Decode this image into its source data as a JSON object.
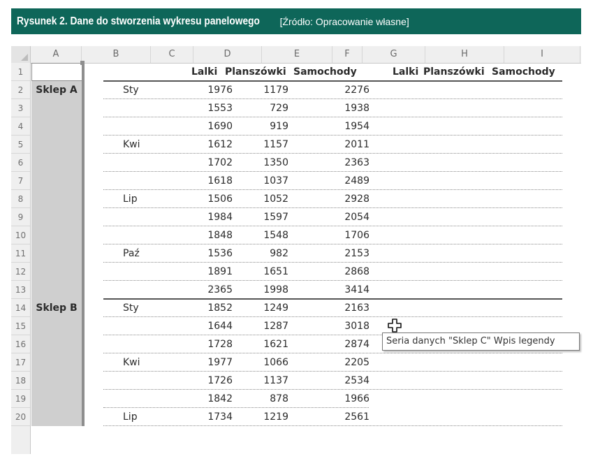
{
  "caption": {
    "title": "Rysunek 2. Dane do stworzenia wykresu panelowego",
    "source": "[Źródło: Opracowanie własne]",
    "background": "#0e6659"
  },
  "columns": [
    "A",
    "B",
    "C",
    "D",
    "E",
    "F",
    "G",
    "H",
    "I"
  ],
  "rows": [
    "1",
    "2",
    "3",
    "4",
    "5",
    "6",
    "7",
    "8",
    "9",
    "10",
    "11",
    "12",
    "13",
    "14",
    "15",
    "16",
    "17",
    "18",
    "19",
    "20"
  ],
  "header_row": {
    "c": "Lalki",
    "d": "Planszówki",
    "e": "Samochody",
    "f": "Lalki",
    "g": "Planszówki",
    "h": "Samochody"
  },
  "stores": {
    "a": "Sklep A",
    "b": "Sklep B"
  },
  "table": [
    {
      "month": "Sty",
      "c": "1976",
      "d": "1179",
      "e": "2276"
    },
    {
      "month": "",
      "c": "1553",
      "d": "729",
      "e": "1938"
    },
    {
      "month": "",
      "c": "1690",
      "d": "919",
      "e": "1954"
    },
    {
      "month": "Kwi",
      "c": "1612",
      "d": "1157",
      "e": "2011"
    },
    {
      "month": "",
      "c": "1702",
      "d": "1350",
      "e": "2363"
    },
    {
      "month": "",
      "c": "1618",
      "d": "1037",
      "e": "2489"
    },
    {
      "month": "Lip",
      "c": "1506",
      "d": "1052",
      "e": "2928"
    },
    {
      "month": "",
      "c": "1984",
      "d": "1597",
      "e": "2054"
    },
    {
      "month": "",
      "c": "1848",
      "d": "1548",
      "e": "1706"
    },
    {
      "month": "Paź",
      "c": "1536",
      "d": "982",
      "e": "2153"
    },
    {
      "month": "",
      "c": "1891",
      "d": "1651",
      "e": "2868"
    },
    {
      "month": "",
      "c": "2365",
      "d": "1998",
      "e": "3414"
    },
    {
      "month": "Sty",
      "c": "1852",
      "d": "1249",
      "e": "2163"
    },
    {
      "month": "",
      "c": "1644",
      "d": "1287",
      "e": "3018"
    },
    {
      "month": "",
      "c": "1728",
      "d": "1621",
      "e": "2874"
    },
    {
      "month": "Kwi",
      "c": "1977",
      "d": "1066",
      "e": "2205"
    },
    {
      "month": "",
      "c": "1726",
      "d": "1137",
      "e": "2534"
    },
    {
      "month": "",
      "c": "1842",
      "d": "878",
      "e": "1966"
    },
    {
      "month": "Lip",
      "c": "1734",
      "d": "1219",
      "e": "2561"
    }
  ],
  "tooltip": {
    "text": "Seria danych \"Sklep C\" Wpis legendy"
  },
  "cursor_icon": "move-cross-icon",
  "colors": {
    "selection_shade": "#cfcfcf",
    "header_bg": "#efefef"
  }
}
